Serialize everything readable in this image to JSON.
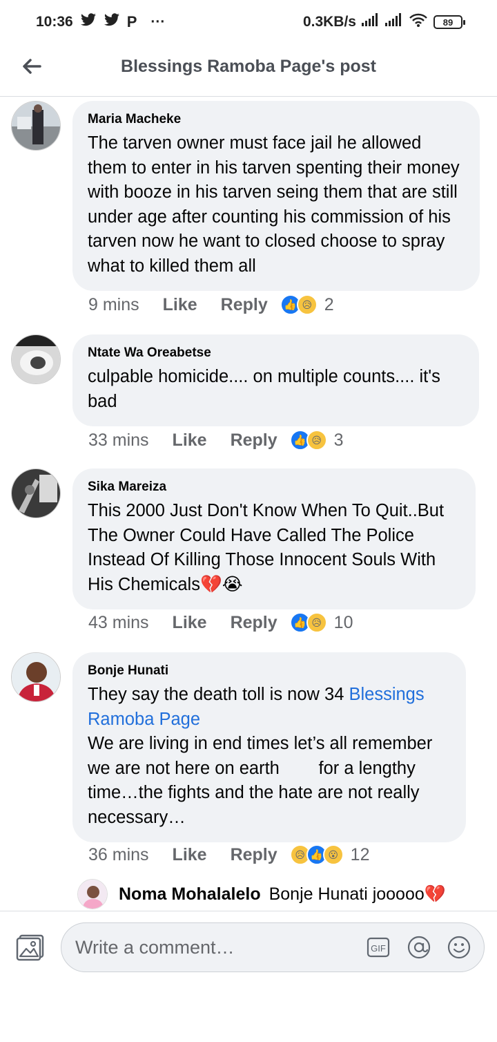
{
  "status_bar": {
    "time": "10:36",
    "app_icons": [
      "twitter-icon",
      "twitter-icon",
      "p-icon"
    ],
    "more": "···",
    "data_speed": "0.3KB/s",
    "battery": "89"
  },
  "header": {
    "title": "Blessings Ramoba Page's post"
  },
  "comments": [
    {
      "author": "Maria Macheke",
      "text": "The tarven owner must face jail he allowed them to enter in his tarven spenting their money with booze in his tarven seing them that are still  under age after counting his commission of his tarven now he want to closed choose to spray what to killed them all",
      "time": "9 mins",
      "like": "Like",
      "reply": "Reply",
      "reactions": [
        "like",
        "sad"
      ],
      "reaction_count": "2"
    },
    {
      "author": "Ntate Wa Oreabetse",
      "text": "culpable homicide.... on multiple counts.... it's bad",
      "time": "33 mins",
      "like": "Like",
      "reply": "Reply",
      "reactions": [
        "like",
        "sad"
      ],
      "reaction_count": "3"
    },
    {
      "author": "Sika Mareiza",
      "text": "This 2000 Just Don't Know When To Quit..But The Owner Could Have Called The Police Instead Of Killing Those Innocent Souls With His Chemicals💔😭",
      "time": "43 mins",
      "like": "Like",
      "reply": "Reply",
      "reactions": [
        "like",
        "sad"
      ],
      "reaction_count": "10"
    },
    {
      "author": "Bonje Hunati",
      "text_before": "They say the death toll is now 34 ",
      "mention": "Blessings Ramoba Page",
      "text_after": "We are living in end times let’s all remember we are not here on earth        for a lengthy time…the fights and the hate are not really necessary…",
      "time": "36 mins",
      "like": "Like",
      "reply": "Reply",
      "reactions": [
        "sad",
        "like",
        "wow"
      ],
      "reaction_count": "12"
    }
  ],
  "reply_preview": {
    "author": "Noma Mohalalelo",
    "text": "Bonje Hunati jooooo💔"
  },
  "composer": {
    "placeholder": "Write a comment…",
    "gif_label": "GIF"
  },
  "colors": {
    "bubble": "#f0f2f5",
    "mention": "#216fdb",
    "like_reaction": "#1877f2",
    "sad_reaction": "#f7c33f",
    "meta_text": "#65676b"
  }
}
